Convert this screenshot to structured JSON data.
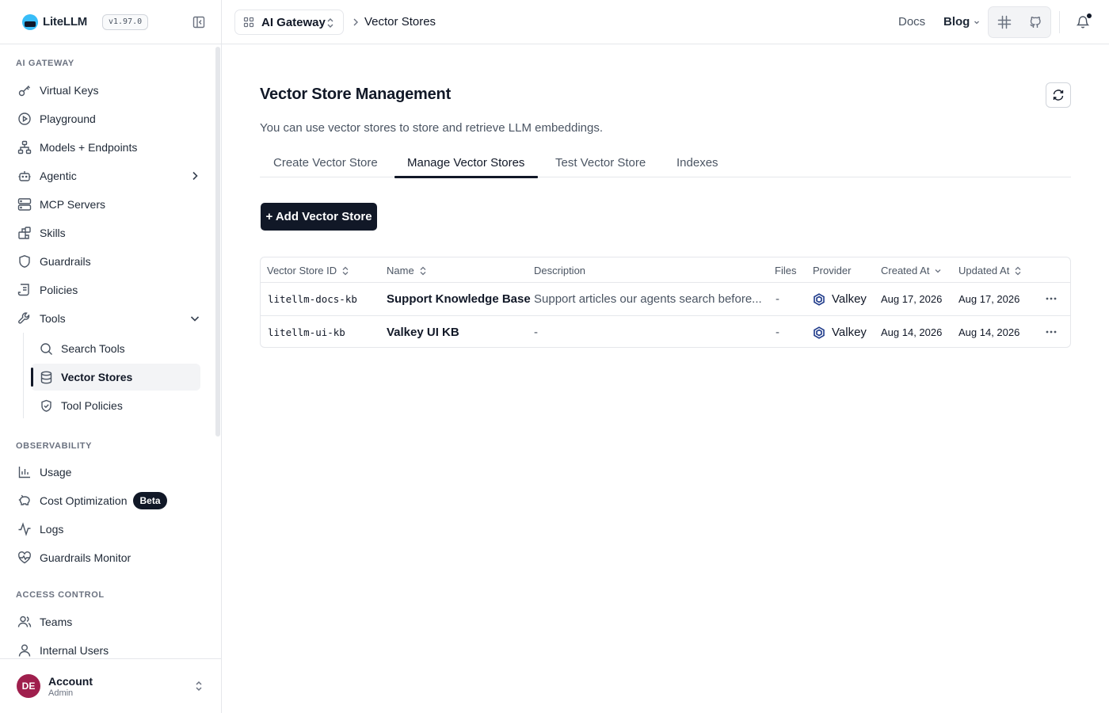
{
  "app": {
    "name": "LiteLLM",
    "version": "v1.97.0"
  },
  "sidebar": {
    "sections": [
      {
        "label": "AI GATEWAY"
      },
      {
        "label": "OBSERVABILITY"
      },
      {
        "label": "ACCESS CONTROL"
      }
    ],
    "items": [
      {
        "label": "Virtual Keys",
        "icon": "key-icon"
      },
      {
        "label": "Playground",
        "icon": "play-circle-icon"
      },
      {
        "label": "Models + Endpoints",
        "icon": "network-icon"
      },
      {
        "label": "Agentic",
        "icon": "bot-icon"
      },
      {
        "label": "MCP Servers",
        "icon": "server-icon"
      },
      {
        "label": "Skills",
        "icon": "blocks-icon"
      },
      {
        "label": "Guardrails",
        "icon": "shield-icon"
      },
      {
        "label": "Policies",
        "icon": "scroll-icon"
      },
      {
        "label": "Tools",
        "icon": "wrench-icon"
      },
      {
        "label": "Usage",
        "icon": "bar-chart-icon"
      },
      {
        "label": "Cost Optimization",
        "icon": "piggy-bank-icon",
        "badge": "Beta"
      },
      {
        "label": "Logs",
        "icon": "activity-icon"
      },
      {
        "label": "Guardrails Monitor",
        "icon": "heart-pulse-icon"
      },
      {
        "label": "Teams",
        "icon": "users-icon"
      },
      {
        "label": "Internal Users",
        "icon": "user-icon"
      }
    ],
    "tools_children": [
      {
        "label": "Search Tools",
        "icon": "search-icon"
      },
      {
        "label": "Vector Stores",
        "icon": "database-icon",
        "active": true
      },
      {
        "label": "Tool Policies",
        "icon": "shield-check-icon"
      }
    ],
    "account": {
      "initials": "DE",
      "name": "Account",
      "role": "Admin"
    }
  },
  "topbar": {
    "workspace": "AI Gateway",
    "breadcrumb": "Vector Stores",
    "docs": "Docs",
    "blog": "Blog"
  },
  "page": {
    "title": "Vector Store Management",
    "description": "You can use vector stores to store and retrieve LLM embeddings.",
    "tabs": [
      {
        "label": "Create Vector Store"
      },
      {
        "label": "Manage Vector Stores",
        "active": true
      },
      {
        "label": "Test Vector Store"
      },
      {
        "label": "Indexes"
      }
    ],
    "add_button": "+ Add Vector Store"
  },
  "table": {
    "columns": [
      "Vector Store ID",
      "Name",
      "Description",
      "Files",
      "Provider",
      "Created At",
      "Updated At"
    ],
    "rows": [
      {
        "id": "litellm-docs-kb",
        "name": "Support Knowledge Base",
        "description": "Support articles our agents search before...",
        "files": "-",
        "provider": "Valkey",
        "created": "Aug 17, 2026",
        "updated": "Aug 17, 2026"
      },
      {
        "id": "litellm-ui-kb",
        "name": "Valkey UI KB",
        "description": "-",
        "files": "-",
        "provider": "Valkey",
        "created": "Aug 14, 2026",
        "updated": "Aug 14, 2026"
      }
    ]
  },
  "colors": {
    "accent": "#111827",
    "provider_icon": "#1e3a8a",
    "avatar": "#9f1f4d"
  }
}
